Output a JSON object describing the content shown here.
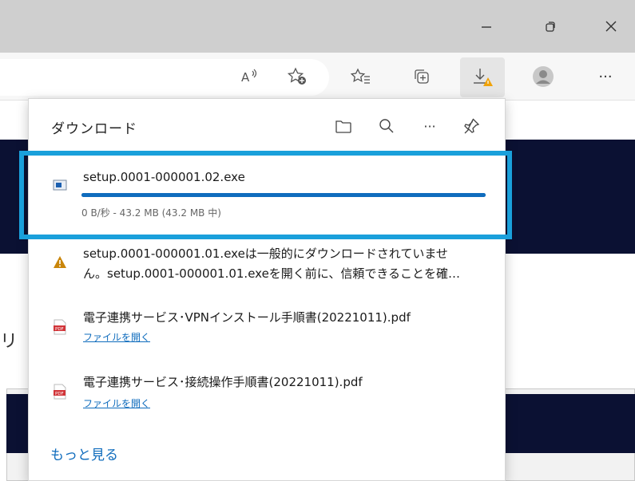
{
  "window": {
    "minimize_icon": "minimize-icon",
    "restore_icon": "restore-icon",
    "close_icon": "close-icon"
  },
  "toolbar": {
    "read_aloud_icon": "read-aloud-icon",
    "add_favorite_icon": "add-favorite-icon",
    "favorites_icon": "favorites-icon",
    "collections_icon": "collections-icon",
    "downloads_icon": "downloads-warning-icon",
    "profile_icon": "profile-icon",
    "more_icon": "more-icon",
    "more_label": "···"
  },
  "page": {
    "partial_text": "リ"
  },
  "downloads": {
    "title": "ダウンロード",
    "open_folder_icon": "folder-icon",
    "search_icon": "search-icon",
    "more_options": "···",
    "pin_icon": "pin-icon",
    "items": [
      {
        "name": "setup.0001-000001.02.exe",
        "status": "0 B/秒 - 43.2 MB (43.2 MB 中)",
        "progress": 1.0,
        "icon": "exe-file-icon"
      },
      {
        "warning_line1": "setup.0001-000001.01.exeは一般的にダウンロードされていませ",
        "warning_line2": "ん。setup.0001-000001.01.exeを開く前に、信頼できることを確…",
        "icon": "warning-icon"
      },
      {
        "name": "電子連携サービス･VPNインストール手順書(20221011).pdf",
        "link": "ファイルを開く",
        "icon": "pdf-file-icon"
      },
      {
        "name": "電子連携サービス･接続操作手順書(20221011).pdf",
        "link": "ファイルを開く",
        "icon": "pdf-file-icon"
      }
    ],
    "see_more": "もっと見る"
  },
  "colors": {
    "accent": "#0f6cbd",
    "highlight": "#1aa0db",
    "navy": "#0b1133",
    "warning": "#f0a30a",
    "pdf_red": "#d13438"
  }
}
